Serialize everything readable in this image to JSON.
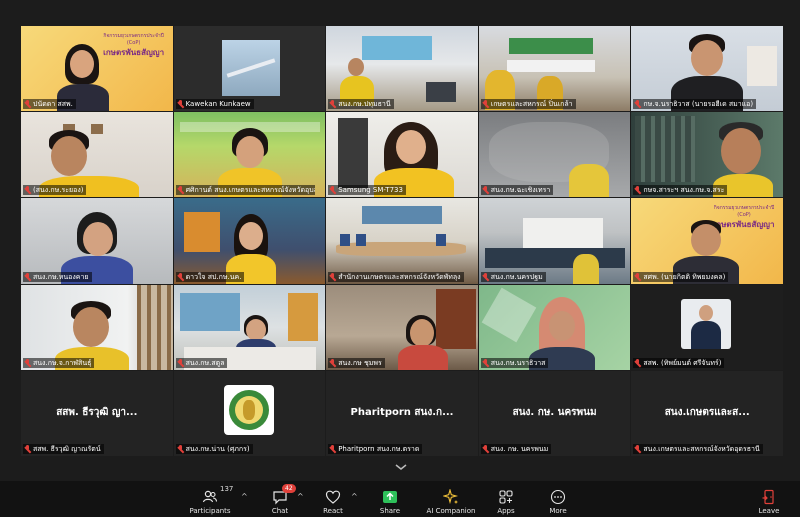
{
  "tiles": [
    {
      "name": "ปนัดดา สสพ.",
      "center": ""
    },
    {
      "name": "Kawekan Kunkaew",
      "center": ""
    },
    {
      "name": "สนง.กษ.ปทุมธานี",
      "center": ""
    },
    {
      "name": "เกษตรและสหกรณ์ ปิ่นเกล้า",
      "center": ""
    },
    {
      "name": "กษ.จ.นราธิวาส (นายรอฮีเด สมาแอ)",
      "center": ""
    },
    {
      "name": "(สนง.กษ.ระยอง)",
      "center": ""
    },
    {
      "name": "ศศิกานต์ สนง.เกษตรและสหกรณ์จังหวัดอุบล...",
      "center": ""
    },
    {
      "name": "Samsung SM-T733",
      "center": ""
    },
    {
      "name": "สนง.กษ.ฉะเชิงเทรา",
      "center": ""
    },
    {
      "name": "กษจ.สาระฯ สนง.กษ.จ.สระ",
      "center": ""
    },
    {
      "name": "สนง.กษ.หนองคาย",
      "center": ""
    },
    {
      "name": "ดาวใจ สป.กษ.นค.",
      "center": ""
    },
    {
      "name": "สำนักงานเกษตรและสหกรณ์จังหวัดพัทลุง",
      "center": ""
    },
    {
      "name": "สนง.กษ.นครปฐม",
      "center": ""
    },
    {
      "name": "สศพ. (นายกิตติ ทิพยมงคล)",
      "center": ""
    },
    {
      "name": "สนง.กษ.จ.กาฬสินธุ์",
      "center": ""
    },
    {
      "name": "สนง.กษ.สตูล",
      "center": ""
    },
    {
      "name": "สนง.กษ ชุมพร",
      "center": ""
    },
    {
      "name": "สนง.กษ.นราธิวาส",
      "center": ""
    },
    {
      "name": "สสพ. (ทิพย์มนต์ ศรีจันทร์)",
      "center": ""
    },
    {
      "name": "สสพ. ธีรวุฒิ ญาณรัตน์",
      "center": "สสพ. ธีรวุฒิ ญา..."
    },
    {
      "name": "สนง.กษ.น่าน (ศุภกร)",
      "center": ""
    },
    {
      "name": "Pharitporn สนง.กษ.ตราด",
      "center": "Pharitporn สนง.ก..."
    },
    {
      "name": "สนง. กษ. นครพนม",
      "center": "สนง. กษ. นครพนม"
    },
    {
      "name": "สนง.เกษตรและสหกรณ์จังหวัดอุดรธานี",
      "center": "สนง.เกษตรและส..."
    }
  ],
  "banner": {
    "line1": "กิจกรรมยุวเกษตรกรประจำปี (CoP)",
    "line2": "เกษตรพันธสัญญา"
  },
  "toolbar": {
    "participants_label": "Participants",
    "participants_count": "137",
    "chat_label": "Chat",
    "chat_badge": "42",
    "react_label": "React",
    "share_label": "Share",
    "ai_label": "AI Companion",
    "apps_label": "Apps",
    "more_label": "More",
    "leave_label": "Leave"
  },
  "colors": {
    "active_border": "#4ad66d",
    "share_green": "#2ec05a",
    "mute_red": "#e0403a",
    "leave_red": "#e0403a"
  }
}
